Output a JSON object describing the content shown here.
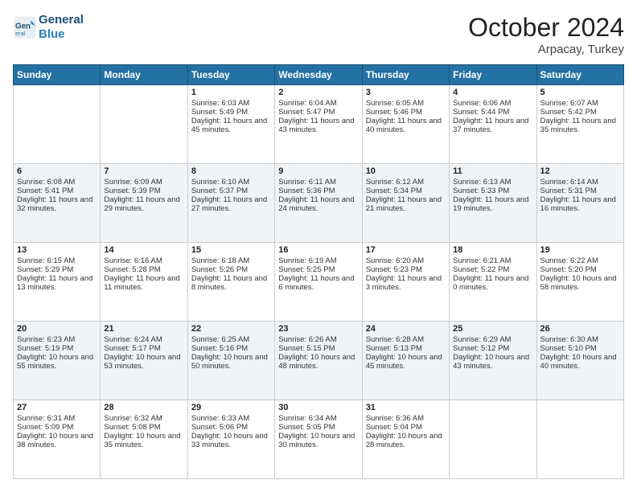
{
  "header": {
    "logo_line1": "General",
    "logo_line2": "Blue",
    "month": "October 2024",
    "location": "Arpacay, Turkey"
  },
  "weekdays": [
    "Sunday",
    "Monday",
    "Tuesday",
    "Wednesday",
    "Thursday",
    "Friday",
    "Saturday"
  ],
  "weeks": [
    [
      {
        "day": "",
        "text": ""
      },
      {
        "day": "",
        "text": ""
      },
      {
        "day": "1",
        "text": "Sunrise: 6:03 AM\nSunset: 5:49 PM\nDaylight: 11 hours and 45 minutes."
      },
      {
        "day": "2",
        "text": "Sunrise: 6:04 AM\nSunset: 5:47 PM\nDaylight: 11 hours and 43 minutes."
      },
      {
        "day": "3",
        "text": "Sunrise: 6:05 AM\nSunset: 5:46 PM\nDaylight: 11 hours and 40 minutes."
      },
      {
        "day": "4",
        "text": "Sunrise: 6:06 AM\nSunset: 5:44 PM\nDaylight: 11 hours and 37 minutes."
      },
      {
        "day": "5",
        "text": "Sunrise: 6:07 AM\nSunset: 5:42 PM\nDaylight: 11 hours and 35 minutes."
      }
    ],
    [
      {
        "day": "6",
        "text": "Sunrise: 6:08 AM\nSunset: 5:41 PM\nDaylight: 11 hours and 32 minutes."
      },
      {
        "day": "7",
        "text": "Sunrise: 6:09 AM\nSunset: 5:39 PM\nDaylight: 11 hours and 29 minutes."
      },
      {
        "day": "8",
        "text": "Sunrise: 6:10 AM\nSunset: 5:37 PM\nDaylight: 11 hours and 27 minutes."
      },
      {
        "day": "9",
        "text": "Sunrise: 6:11 AM\nSunset: 5:36 PM\nDaylight: 11 hours and 24 minutes."
      },
      {
        "day": "10",
        "text": "Sunrise: 6:12 AM\nSunset: 5:34 PM\nDaylight: 11 hours and 21 minutes."
      },
      {
        "day": "11",
        "text": "Sunrise: 6:13 AM\nSunset: 5:33 PM\nDaylight: 11 hours and 19 minutes."
      },
      {
        "day": "12",
        "text": "Sunrise: 6:14 AM\nSunset: 5:31 PM\nDaylight: 11 hours and 16 minutes."
      }
    ],
    [
      {
        "day": "13",
        "text": "Sunrise: 6:15 AM\nSunset: 5:29 PM\nDaylight: 11 hours and 13 minutes."
      },
      {
        "day": "14",
        "text": "Sunrise: 6:16 AM\nSunset: 5:28 PM\nDaylight: 11 hours and 11 minutes."
      },
      {
        "day": "15",
        "text": "Sunrise: 6:18 AM\nSunset: 5:26 PM\nDaylight: 11 hours and 8 minutes."
      },
      {
        "day": "16",
        "text": "Sunrise: 6:19 AM\nSunset: 5:25 PM\nDaylight: 11 hours and 6 minutes."
      },
      {
        "day": "17",
        "text": "Sunrise: 6:20 AM\nSunset: 5:23 PM\nDaylight: 11 hours and 3 minutes."
      },
      {
        "day": "18",
        "text": "Sunrise: 6:21 AM\nSunset: 5:22 PM\nDaylight: 11 hours and 0 minutes."
      },
      {
        "day": "19",
        "text": "Sunrise: 6:22 AM\nSunset: 5:20 PM\nDaylight: 10 hours and 58 minutes."
      }
    ],
    [
      {
        "day": "20",
        "text": "Sunrise: 6:23 AM\nSunset: 5:19 PM\nDaylight: 10 hours and 55 minutes."
      },
      {
        "day": "21",
        "text": "Sunrise: 6:24 AM\nSunset: 5:17 PM\nDaylight: 10 hours and 53 minutes."
      },
      {
        "day": "22",
        "text": "Sunrise: 6:25 AM\nSunset: 5:16 PM\nDaylight: 10 hours and 50 minutes."
      },
      {
        "day": "23",
        "text": "Sunrise: 6:26 AM\nSunset: 5:15 PM\nDaylight: 10 hours and 48 minutes."
      },
      {
        "day": "24",
        "text": "Sunrise: 6:28 AM\nSunset: 5:13 PM\nDaylight: 10 hours and 45 minutes."
      },
      {
        "day": "25",
        "text": "Sunrise: 6:29 AM\nSunset: 5:12 PM\nDaylight: 10 hours and 43 minutes."
      },
      {
        "day": "26",
        "text": "Sunrise: 6:30 AM\nSunset: 5:10 PM\nDaylight: 10 hours and 40 minutes."
      }
    ],
    [
      {
        "day": "27",
        "text": "Sunrise: 6:31 AM\nSunset: 5:09 PM\nDaylight: 10 hours and 38 minutes."
      },
      {
        "day": "28",
        "text": "Sunrise: 6:32 AM\nSunset: 5:08 PM\nDaylight: 10 hours and 35 minutes."
      },
      {
        "day": "29",
        "text": "Sunrise: 6:33 AM\nSunset: 5:06 PM\nDaylight: 10 hours and 33 minutes."
      },
      {
        "day": "30",
        "text": "Sunrise: 6:34 AM\nSunset: 5:05 PM\nDaylight: 10 hours and 30 minutes."
      },
      {
        "day": "31",
        "text": "Sunrise: 6:36 AM\nSunset: 5:04 PM\nDaylight: 10 hours and 28 minutes."
      },
      {
        "day": "",
        "text": ""
      },
      {
        "day": "",
        "text": ""
      }
    ]
  ]
}
